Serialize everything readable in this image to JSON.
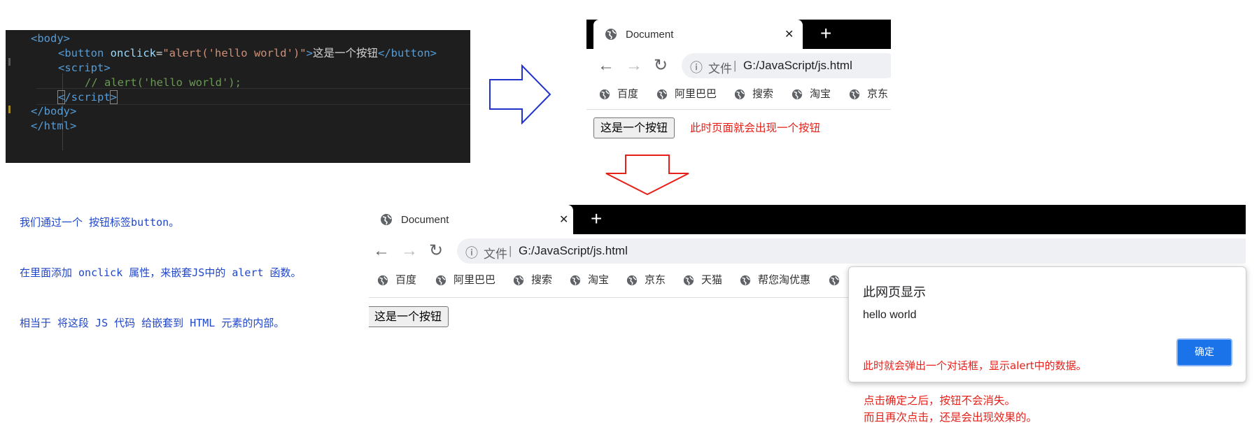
{
  "code": {
    "lines": [
      {
        "parts": [
          {
            "t": "<body>",
            "c": "tag"
          }
        ]
      },
      {
        "parts": [
          {
            "t": "<button ",
            "c": "tag"
          },
          {
            "t": "onclick",
            "c": "attr"
          },
          {
            "t": "=",
            "c": "txt"
          },
          {
            "t": "\"alert('hello world')\"",
            "c": "str"
          },
          {
            "t": ">",
            "c": "tag"
          },
          {
            "t": "这是一个按钮",
            "c": "txt"
          },
          {
            "t": "</button>",
            "c": "tag"
          }
        ]
      },
      {
        "parts": [
          {
            "t": "<script>",
            "c": "tag"
          }
        ]
      },
      {
        "parts": [
          {
            "t": "// alert('hello world');",
            "c": "cmt"
          }
        ]
      },
      {
        "parts": [
          {
            "t": "<",
            "c": "tag bracket"
          },
          {
            "t": "/script",
            "c": "tag"
          },
          {
            "t": ">",
            "c": "tag bracket"
          }
        ]
      },
      {
        "parts": [
          {
            "t": "</body>",
            "c": "tag"
          }
        ]
      },
      {
        "parts": [
          {
            "t": "</html>",
            "c": "tag"
          }
        ]
      }
    ]
  },
  "note_blue": [
    "我们通过一个 按钮标签button。",
    "在里面添加 onclick 属性，来嵌套JS中的 alert 函数。",
    "相当于 将这段 JS 代码 给嵌套到 HTML 元素的内部。"
  ],
  "browser": {
    "tab_title": "Document",
    "close_glyph": "✕",
    "new_tab_glyph": "+",
    "back_glyph": "←",
    "forward_glyph": "→",
    "reload_glyph": "↻",
    "info_glyph": "ⓘ",
    "file_label": "文件",
    "separator": "|",
    "url": "G:/JavaScript/js.html",
    "bookmarks_small": [
      "百度",
      "阿里巴巴",
      "搜索",
      "淘宝",
      "京东"
    ],
    "bookmarks_large": [
      "百度",
      "阿里巴巴",
      "搜索",
      "淘宝",
      "京东",
      "天猫",
      "帮您淘优惠"
    ],
    "page_button": "这是一个按钮"
  },
  "annotation_top": "此时页面就会出现一个按钮",
  "dialog": {
    "title": "此网页显示",
    "message": "hello world",
    "ok": "确定",
    "note": "此时就会弹出一个对话框，显示alert中的数据。"
  },
  "bottom_note": [
    "点击确定之后，按钮不会消失。",
    "而且再次点击，还是会出现效果的。"
  ],
  "colors": {
    "annotation_red": "#e8201a",
    "annotation_blue": "#2046c9",
    "arrow_blue": "#2233cc",
    "arrow_red": "#e8201a",
    "dialog_button": "#1a73e8"
  }
}
